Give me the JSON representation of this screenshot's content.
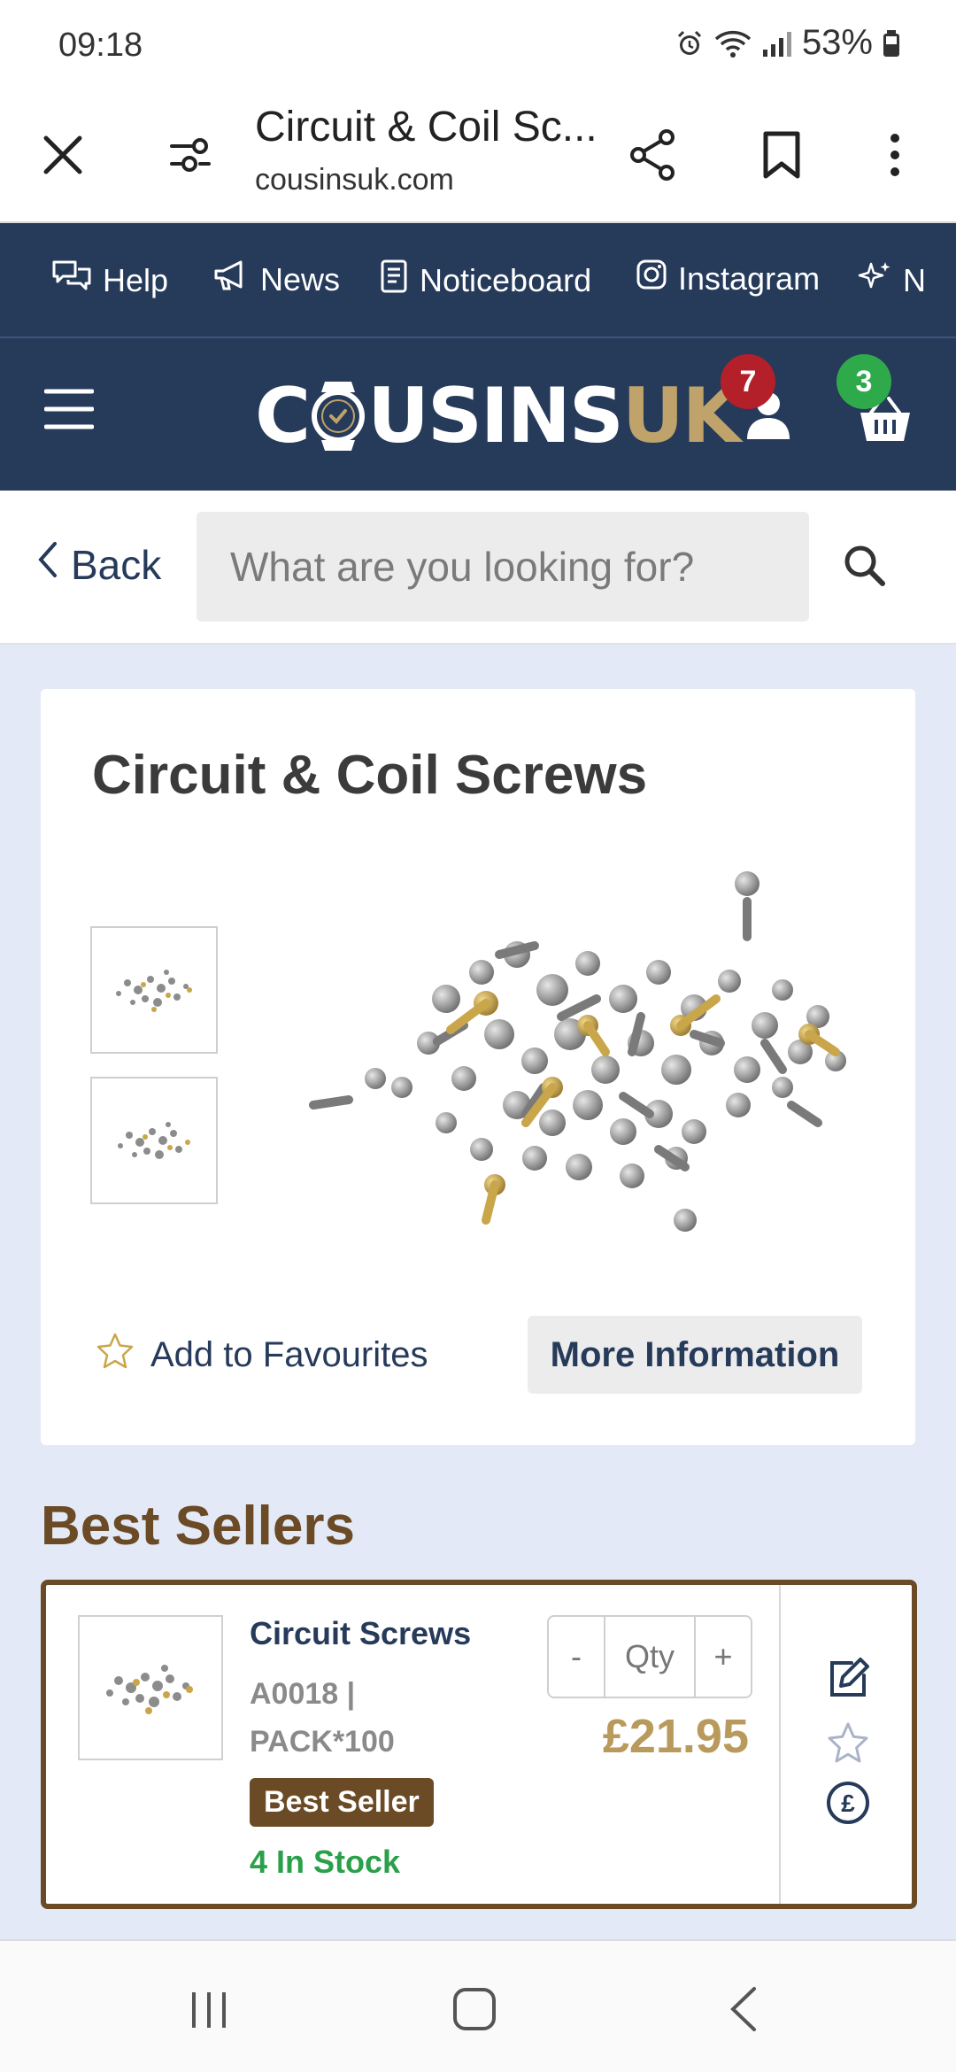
{
  "status_bar": {
    "time": "09:18",
    "battery": "53%"
  },
  "browser": {
    "page_title": "Circuit & Coil Sc...",
    "url": "cousinsuk.com"
  },
  "info_bar": {
    "items": [
      {
        "label": "Help",
        "icon": "chat-bubbles-icon"
      },
      {
        "label": "News",
        "icon": "megaphone-icon"
      },
      {
        "label": "Noticeboard",
        "icon": "notebook-icon"
      },
      {
        "label": "Instagram",
        "icon": "instagram-icon"
      },
      {
        "label": "N",
        "icon": "sparkle-icon"
      }
    ]
  },
  "header": {
    "logo_white": "C",
    "logo_white_2": "USINS",
    "logo_gold": "UK",
    "account_badge": "7",
    "basket_badge": "3"
  },
  "search": {
    "back_label": "Back",
    "placeholder": "What are you looking for?"
  },
  "product": {
    "title": "Circuit & Coil Screws",
    "add_to_favourites": "Add to Favourites",
    "more_information": "More Information"
  },
  "best_sellers": {
    "heading": "Best Sellers",
    "items": [
      {
        "name": "Circuit Screws",
        "sku": "A0018 |",
        "pack": "PACK*100",
        "badge": "Best Seller",
        "stock": "4 In Stock",
        "qty_minus": "-",
        "qty_placeholder": "Qty",
        "qty_plus": "+",
        "price": "£21.95"
      }
    ]
  },
  "colors": {
    "navy": "#263a5a",
    "brown": "#6b4a26",
    "gold": "#b89a5c",
    "green": "#2aa04a",
    "account_badge": "#b3202a",
    "basket_badge": "#2faa4a",
    "page_bg": "#e3e9f6"
  }
}
